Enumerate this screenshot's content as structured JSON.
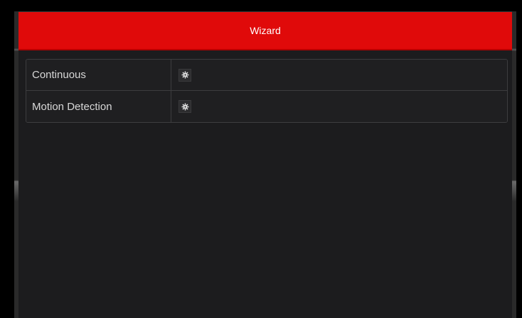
{
  "dialog": {
    "title": "Wizard"
  },
  "rows": [
    {
      "label": "Continuous",
      "action_icon": "gear-icon"
    },
    {
      "label": "Motion Detection",
      "action_icon": "gear-icon"
    }
  ],
  "colors": {
    "titlebar": "#e00a0a",
    "background": "#1c1c1e",
    "row_border": "#3d3d3f",
    "text": "#d8d8d8"
  }
}
